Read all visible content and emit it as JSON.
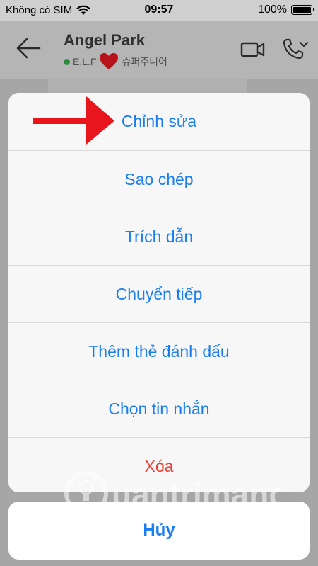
{
  "status_bar": {
    "carrier": "Không có SIM",
    "time": "09:57",
    "battery": "100%",
    "battery_level": 1.0
  },
  "header": {
    "contact_name": "Angel Park",
    "status_left": "E.L.F",
    "status_right": "슈퍼주니어",
    "icons": {
      "back": "back-arrow-icon",
      "video": "video-call-icon",
      "call": "phone-call-icon"
    }
  },
  "action_sheet": {
    "items": [
      {
        "label": "Chỉnh sửa"
      },
      {
        "label": "Sao chép"
      },
      {
        "label": "Trích dẫn"
      },
      {
        "label": "Chuyển tiếp"
      },
      {
        "label": "Thêm thẻ đánh dấu"
      },
      {
        "label": "Chọn tin nhắn"
      },
      {
        "label": "Xóa"
      }
    ],
    "cancel_label": "Hủy"
  },
  "watermark": {
    "brand": "uantrimang"
  },
  "colors": {
    "action_blue": "#1a7ef2",
    "destructive_red": "#f23a2f",
    "annotation_arrow": "#e8151d",
    "online_green": "#2e8b3e"
  }
}
